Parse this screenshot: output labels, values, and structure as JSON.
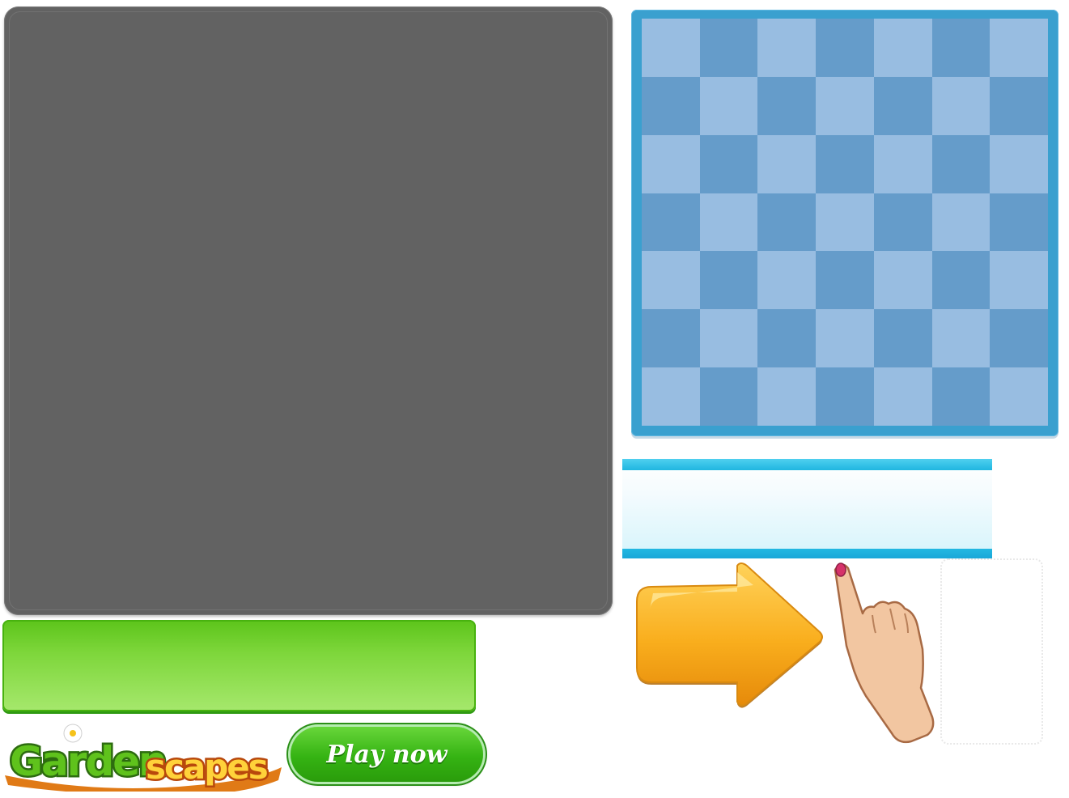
{
  "play_button": {
    "label": "Play now"
  },
  "logo": {
    "text_garden": "Garden",
    "text_scapes": "scapes"
  },
  "board": {
    "rows": 7,
    "cols": 7,
    "light_color": "#98bde1",
    "dark_color": "#659cca"
  },
  "colors": {
    "panel_dark": "#626262",
    "board_frame": "#3aa0cf",
    "cyan_accent": "#20b6e0",
    "green_accent": "#48b20f",
    "arrow_orange": "#f5a418"
  },
  "icons": {
    "arrow": "right-arrow-icon",
    "hand": "pointing-hand-icon"
  }
}
